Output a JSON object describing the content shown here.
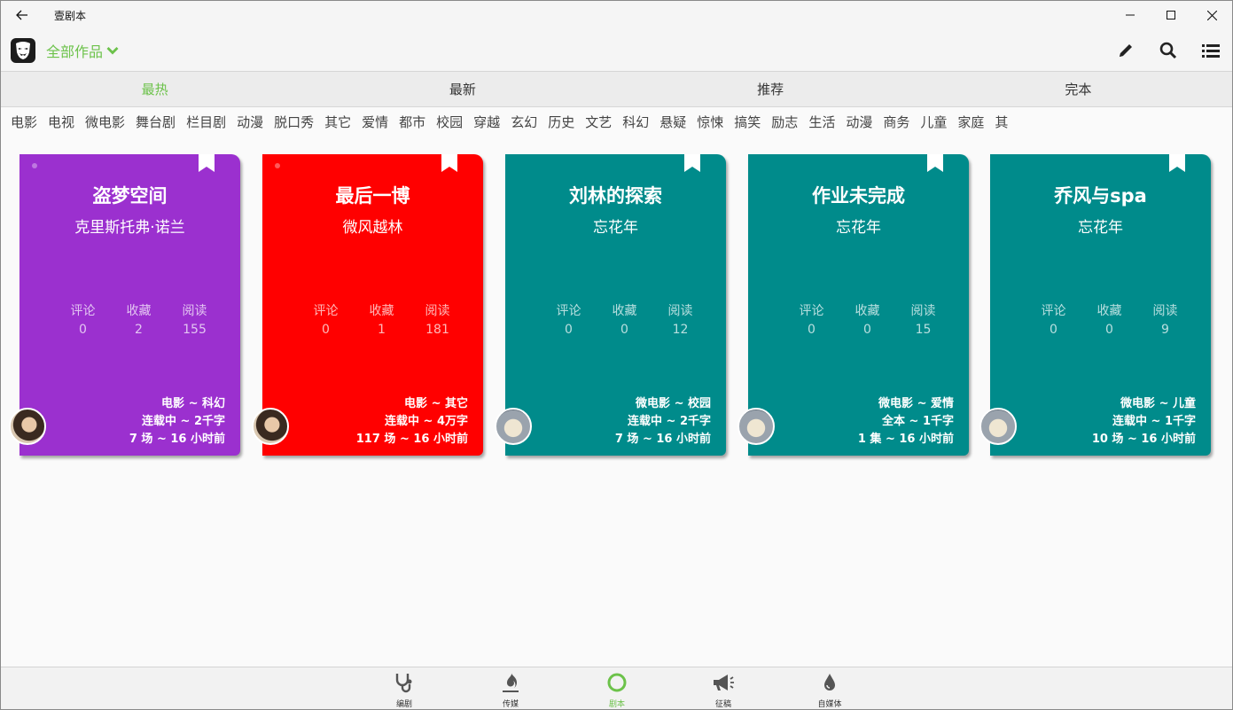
{
  "window": {
    "title": "壹剧本"
  },
  "header": {
    "works_label": "全部作品"
  },
  "sort_tabs": [
    {
      "label": "最热",
      "active": true
    },
    {
      "label": "最新",
      "active": false
    },
    {
      "label": "推荐",
      "active": false
    },
    {
      "label": "完本",
      "active": false
    }
  ],
  "categories": [
    "电影",
    "电视",
    "微电影",
    "舞台剧",
    "栏目剧",
    "动漫",
    "脱口秀",
    "其它",
    "爱情",
    "都市",
    "校园",
    "穿越",
    "玄幻",
    "历史",
    "文艺",
    "科幻",
    "悬疑",
    "惊悚",
    "搞笑",
    "励志",
    "生活",
    "动漫",
    "商务",
    "儿童",
    "家庭",
    "其"
  ],
  "stat_labels": {
    "comments": "评论",
    "favorites": "收藏",
    "reads": "阅读"
  },
  "cards": [
    {
      "title": "盗梦空间",
      "author": "克里斯托弗·诺兰",
      "comments": "0",
      "favorites": "2",
      "reads": "155",
      "genre": "电影 ~ 科幻",
      "status": "连载中 ~ 2千字",
      "scenes": "7 场 ~ 16 小时前",
      "color": "#9b30cf",
      "avatar": "woman"
    },
    {
      "title": "最后一博",
      "author": "微风越林",
      "comments": "0",
      "favorites": "1",
      "reads": "181",
      "genre": "电影 ~ 其它",
      "status": "连载中 ~ 4万字",
      "scenes": "117 场 ~ 16 小时前",
      "color": "#ff0000",
      "avatar": "woman"
    },
    {
      "title": "刘林的探索",
      "author": "忘花年",
      "comments": "0",
      "favorites": "0",
      "reads": "12",
      "genre": "微电影 ~ 校园",
      "status": "连载中 ~ 2千字",
      "scenes": "7 场 ~ 16 小时前",
      "color": "#008b8b",
      "avatar": "dog"
    },
    {
      "title": "作业未完成",
      "author": "忘花年",
      "comments": "0",
      "favorites": "0",
      "reads": "15",
      "genre": "微电影 ~ 爱情",
      "status": "全本 ~ 1千字",
      "scenes": "1 集 ~ 16 小时前",
      "color": "#008b8b",
      "avatar": "dog"
    },
    {
      "title": "乔风与spa",
      "author": "忘花年",
      "comments": "0",
      "favorites": "0",
      "reads": "9",
      "genre": "微电影 ~ 儿童",
      "status": "连载中 ~ 1千字",
      "scenes": "10 场 ~ 16 小时前",
      "color": "#008b8b",
      "avatar": "dog"
    }
  ],
  "bottom_nav": [
    {
      "label": "编剧",
      "icon": "stethoscope-icon",
      "active": false
    },
    {
      "label": "传媒",
      "icon": "flame-icon",
      "active": false
    },
    {
      "label": "剧本",
      "icon": "circle-icon",
      "active": true
    },
    {
      "label": "征稿",
      "icon": "megaphone-icon",
      "active": false
    },
    {
      "label": "自媒体",
      "icon": "drop-icon",
      "active": false
    }
  ],
  "colors": {
    "accent": "#6cc24a",
    "purple": "#9b30cf",
    "red": "#ff0000",
    "teal": "#008b8b"
  }
}
